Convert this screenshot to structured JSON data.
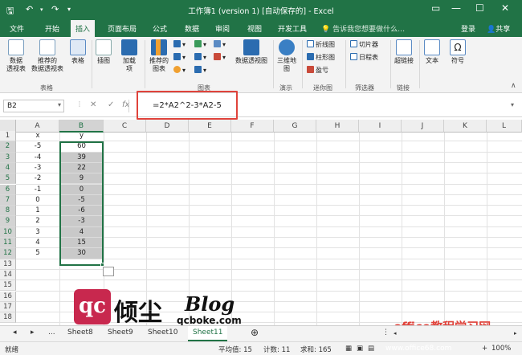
{
  "title": "工作簿1 (version 1) [自动保存的] - Excel",
  "tabs": [
    "文件",
    "开始",
    "插入",
    "页面布局",
    "公式",
    "数据",
    "审阅",
    "视图",
    "开发工具"
  ],
  "tell_me": "告诉我您想要做什么…",
  "login": "登录",
  "share": "共享",
  "ribbon": {
    "pivot": "数据\n透视表",
    "rec_pivot": "推荐的\n数据透视表",
    "table": "表格",
    "illus": "插图",
    "addins": "加载\n项",
    "rec_charts": "推荐的\n图表",
    "pivot_chart": "数据透视图",
    "map3d": "三维地\n图",
    "line": "折线图",
    "column": "柱形图",
    "winloss": "盈亏",
    "slicer": "切片器",
    "timeline": "日程表",
    "link": "超链接",
    "text": "文本",
    "symbol": "符号",
    "g_table": "表格",
    "g_chart": "图表",
    "g_demo": "演示",
    "g_spark": "迷你图",
    "g_filter": "筛选器",
    "g_link": "链接"
  },
  "namebox": "B2",
  "formula": "=2*A2^2-3*A2-5",
  "columns": [
    "A",
    "B",
    "C",
    "D",
    "E",
    "F",
    "G",
    "H",
    "I",
    "J",
    "K",
    "L"
  ],
  "rows": [
    "1",
    "2",
    "3",
    "4",
    "5",
    "6",
    "7",
    "8",
    "9",
    "10",
    "11",
    "12",
    "13",
    "14",
    "15",
    "16",
    "17",
    "18"
  ],
  "colA": [
    "x",
    "-5",
    "-4",
    "-3",
    "-2",
    "-1",
    "0",
    "1",
    "2",
    "3",
    "4",
    "5"
  ],
  "colB": [
    "y",
    "60",
    "39",
    "22",
    "9",
    "0",
    "-5",
    "-6",
    "-3",
    "4",
    "15",
    "30"
  ],
  "sheets": {
    "more": "...",
    "s1": "Sheet8",
    "s2": "Sheet9",
    "s3": "Sheet10",
    "s4": "Sheet11"
  },
  "status": {
    "ready": "就绪",
    "avg": "平均值: 15",
    "count": "计数: 11",
    "sum": "求和: 165",
    "zoom": "100%"
  },
  "watermark": {
    "brand": "倾尘",
    "blog": "Blog",
    "site": "qcboke.com",
    "office": "office教程学习网",
    "office_url": "www.office68.com"
  },
  "colors": {
    "excel_green": "#217346",
    "highlight": "#e0433b"
  }
}
